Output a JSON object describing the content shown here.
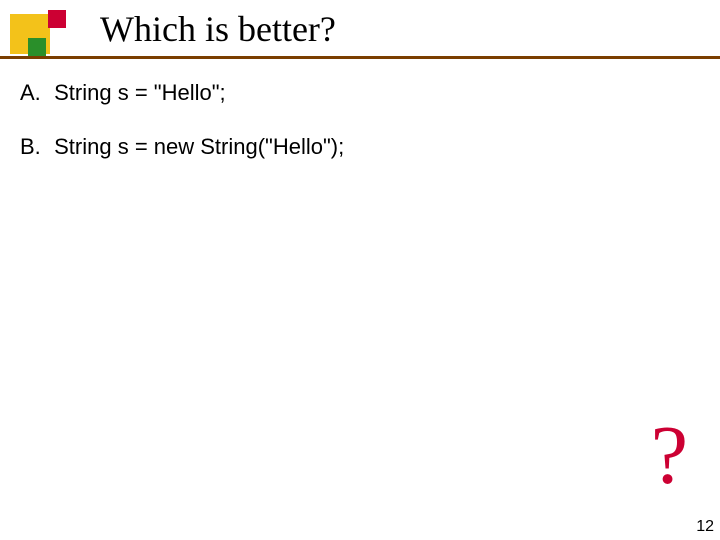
{
  "title": "Which is better?",
  "items": [
    {
      "label": "A.",
      "text": "String s = \"Hello\";"
    },
    {
      "label": "B.",
      "text": "String s = new String(\"Hello\");"
    }
  ],
  "questionMark": "?",
  "pageNumber": "12"
}
